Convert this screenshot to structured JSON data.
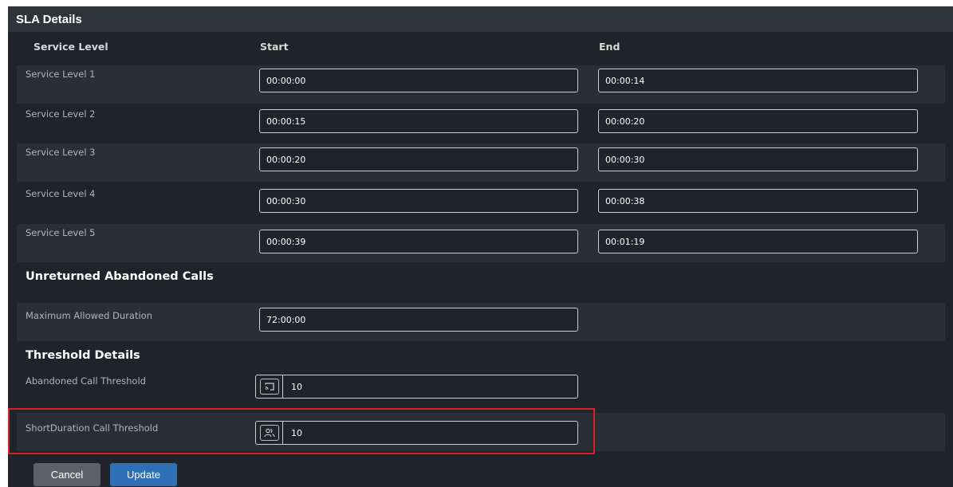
{
  "header": {
    "title": "SLA Details"
  },
  "columns": {
    "service_level": "Service Level",
    "start": "Start",
    "end": "End"
  },
  "service_levels": [
    {
      "label": "Service Level 1",
      "start": "00:00:00",
      "end": "00:00:14"
    },
    {
      "label": "Service Level 2",
      "start": "00:00:15",
      "end": "00:00:20"
    },
    {
      "label": "Service Level 3",
      "start": "00:00:20",
      "end": "00:00:30"
    },
    {
      "label": "Service Level 4",
      "start": "00:00:30",
      "end": "00:00:38"
    },
    {
      "label": "Service Level 5",
      "start": "00:00:39",
      "end": "00:01:19"
    }
  ],
  "unreturned": {
    "title": "Unreturned Abandoned Calls",
    "max_duration_label": "Maximum Allowed Duration",
    "max_duration_value": "72:00:00"
  },
  "threshold": {
    "title": "Threshold Details",
    "abandoned_label": "Abandoned Call Threshold",
    "abandoned_value": "10",
    "abandoned_icon": "cast-icon",
    "short_label": "ShortDuration Call Threshold",
    "short_value": "10",
    "short_icon": "users-icon"
  },
  "buttons": {
    "cancel": "Cancel",
    "update": "Update"
  },
  "colors": {
    "panel_bg": "#20232a",
    "alt_row": "#2b2e35",
    "highlight": "#d8202c",
    "update_btn": "#2f6fb5",
    "cancel_btn": "#5c6068"
  }
}
